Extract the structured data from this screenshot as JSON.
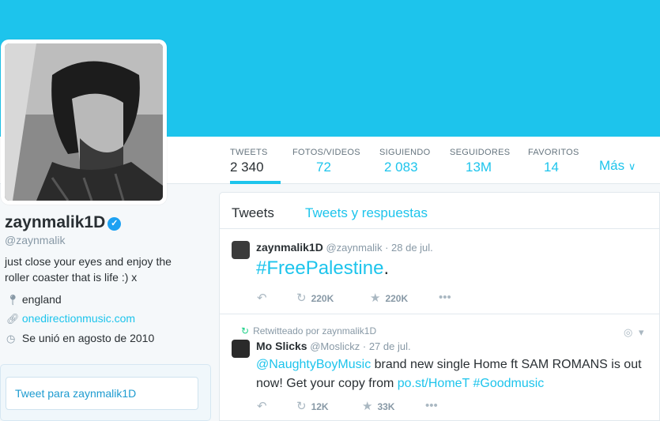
{
  "profile": {
    "name": "zaynmalik1D",
    "handle": "@zaynmalik",
    "bio_line1": "just close your eyes and enjoy the",
    "bio_line2": "roller coaster that is life :) x",
    "location": "england",
    "website": "onedirectionmusic.com",
    "joined": "Se unió en agosto de 2010",
    "verified_glyph": "✓"
  },
  "nav": [
    {
      "label": "TWEETS",
      "value": "2 340"
    },
    {
      "label": "FOTOS/VIDEOS",
      "value": "72"
    },
    {
      "label": "SIGUIENDO",
      "value": "2 083"
    },
    {
      "label": "SEGUIDORES",
      "value": "13M"
    },
    {
      "label": "FAVORITOS",
      "value": "14"
    }
  ],
  "more_label": "Más",
  "tweet_box_label": "Tweet para zaynmalik1D",
  "tabs": {
    "tweets": "Tweets",
    "replies": "Tweets y respuestas"
  },
  "tweet1": {
    "name": "zaynmalik1D",
    "handle": "@zaynmalik",
    "date": "· 28 de jul.",
    "hashtag": "#FreePalestine",
    "tail": ".",
    "retweets": "220K",
    "favorites": "220K"
  },
  "tweet2": {
    "retweeted_by": "Retwitteado por zaynmalik1D",
    "name": "Mo Slicks",
    "handle": "@Moslickz",
    "date": "· 27 de jul.",
    "mention": "@NaughtyBoyMusic",
    "text_a": " brand new single Home ft SAM ROMANS is out now! Get your copy from ",
    "link": "po.st/HomeT",
    "hashtag": " #Goodmusic",
    "retweets": "12K",
    "favorites": "33K"
  },
  "colors": {
    "accent": "#1dc4ec",
    "header": "#1dc4ec",
    "verified": "#1da1f2",
    "retweet": "#19cf86"
  }
}
